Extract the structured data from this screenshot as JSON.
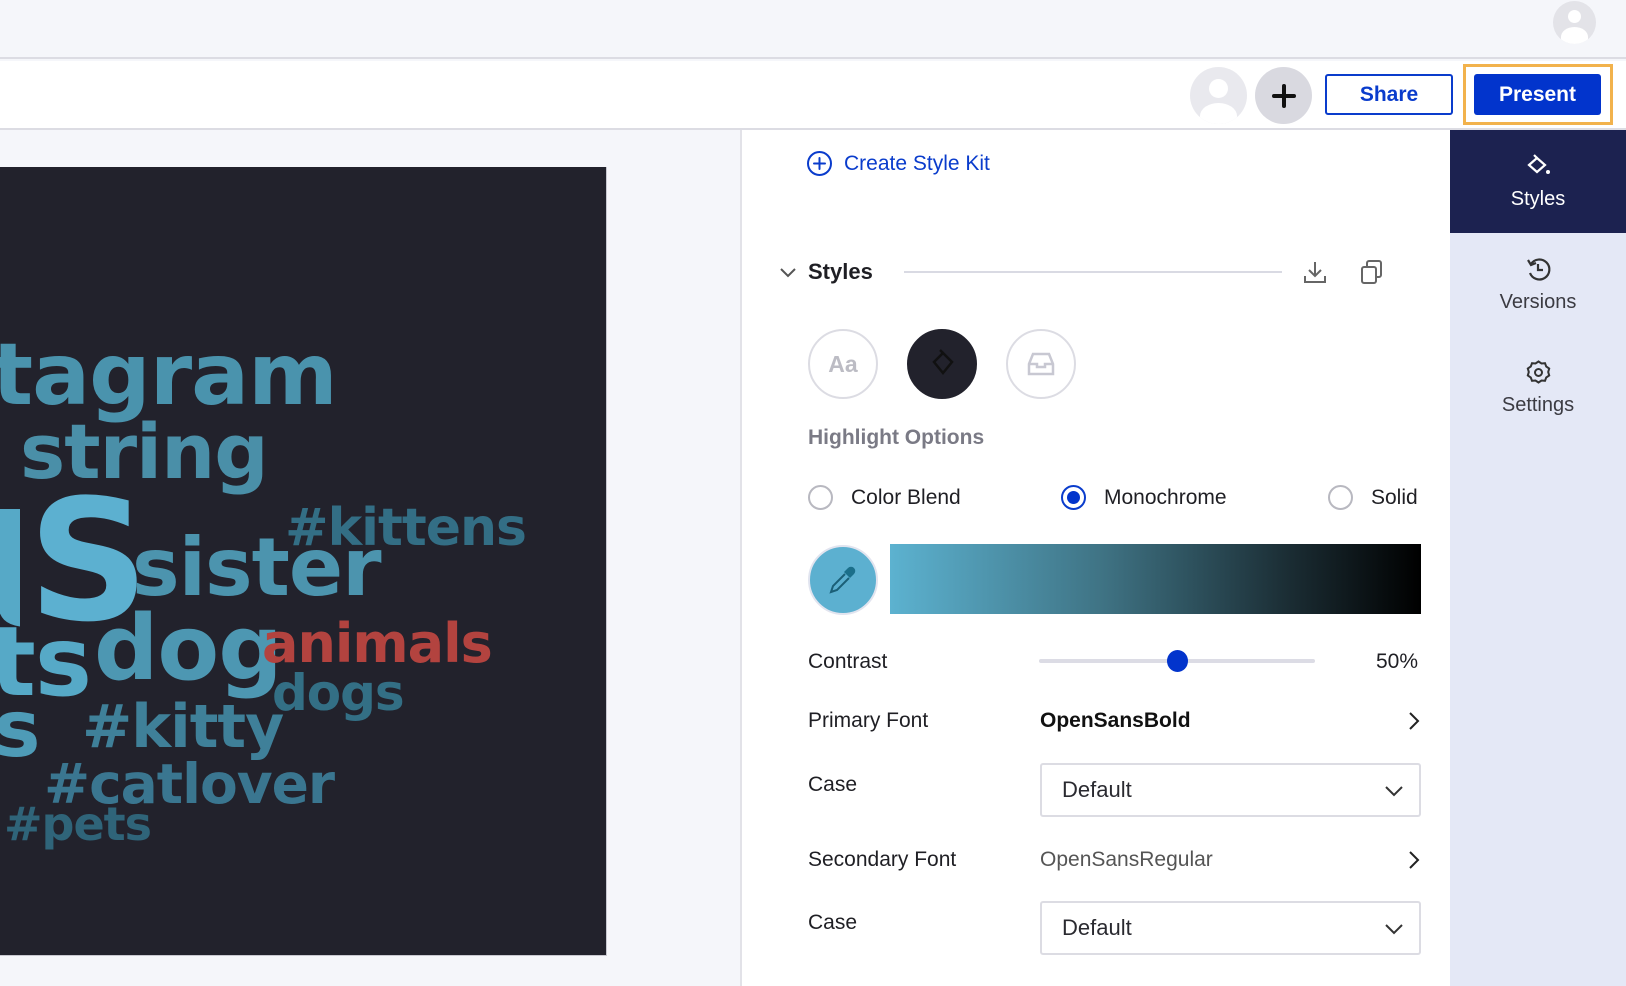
{
  "topbar": {
    "avatar_icon": "user-avatar-icon"
  },
  "toolbar": {
    "collaborator_icon": "user-avatar-icon",
    "add_icon": "plus-icon",
    "share_label": "Share",
    "present_label": "Present"
  },
  "canvas": {
    "background": "#22222c",
    "words": [
      {
        "text": "tagram",
        "color": "#4a93ad"
      },
      {
        "text": "string",
        "color": "#4a8fa8"
      },
      {
        "text": "S",
        "color": "#5cb0d0"
      },
      {
        "text": "sister",
        "color": "#4c94ae"
      },
      {
        "text": "#kittens",
        "color": "#336e85"
      },
      {
        "text": "ts",
        "color": "#56a9c7"
      },
      {
        "text": "dog",
        "color": "#4d97b2"
      },
      {
        "text": "animals",
        "color": "#b3433f"
      },
      {
        "text": "dogs",
        "color": "#336f85"
      },
      {
        "text": "s",
        "color": "#4e9bb7"
      },
      {
        "text": "#kitty",
        "color": "#3f8099"
      },
      {
        "text": "#catlover",
        "color": "#3a7690"
      },
      {
        "text": "#pets",
        "color": "#2f6479"
      }
    ]
  },
  "panel": {
    "cutoff_text": "",
    "create_style_kit": "Create Style Kit",
    "styles_section": {
      "title": "Styles",
      "expanded": true,
      "download_icon": "download-icon",
      "duplicate_icon": "duplicate-icon"
    },
    "style_types": [
      {
        "name": "typography",
        "label": "Aa",
        "active": false
      },
      {
        "name": "color",
        "icon": "paint-bucket-icon",
        "active": true
      },
      {
        "name": "layout",
        "icon": "inbox-tray-icon",
        "active": false
      }
    ],
    "highlight_options": {
      "label": "Highlight Options",
      "options": [
        {
          "label": "Color Blend",
          "selected": false
        },
        {
          "label": "Monochrome",
          "selected": true
        },
        {
          "label": "Solid",
          "selected": false
        }
      ]
    },
    "color": {
      "base_color": "#5cb0d0",
      "gradient_start": "#5cb2d0",
      "gradient_end": "#000000"
    },
    "contrast": {
      "label": "Contrast",
      "value": 50,
      "display": "50%"
    },
    "primary_font": {
      "label": "Primary Font",
      "value": "OpenSansBold"
    },
    "primary_case": {
      "label": "Case",
      "value": "Default"
    },
    "secondary_font": {
      "label": "Secondary Font",
      "value": "OpenSansRegular"
    },
    "secondary_case": {
      "label": "Case",
      "value": "Default"
    }
  },
  "sidebar": {
    "items": [
      {
        "label": "Styles",
        "icon": "paint-bucket-icon",
        "active": true
      },
      {
        "label": "Versions",
        "icon": "history-icon",
        "active": false
      },
      {
        "label": "Settings",
        "icon": "gear-icon",
        "active": false
      }
    ]
  }
}
